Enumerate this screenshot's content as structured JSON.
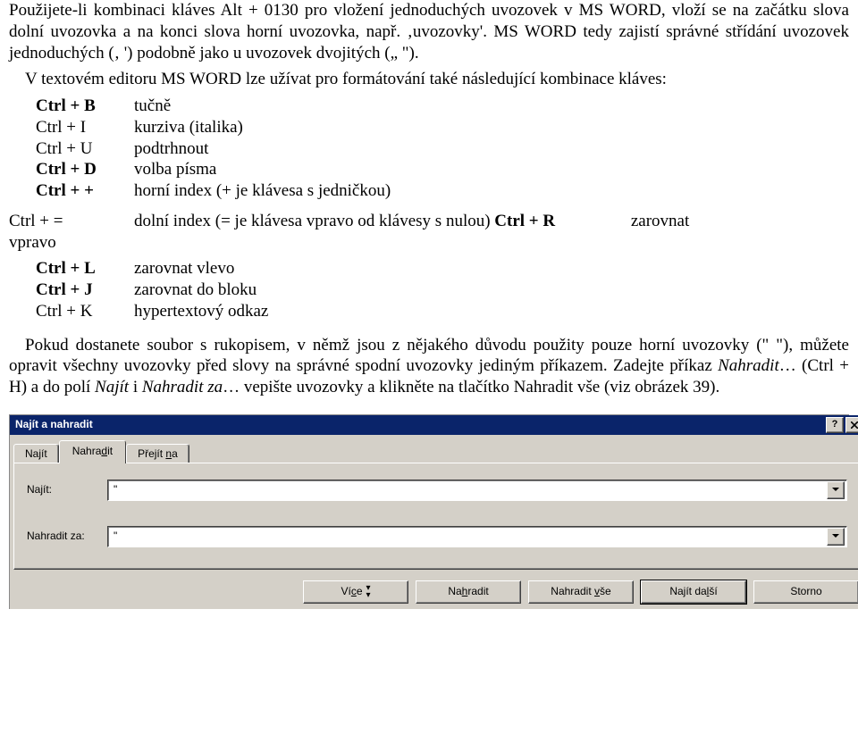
{
  "doc": {
    "p1": "Použijete-li kombinaci kláves Alt + 0130 pro vložení jednoduchých uvozovek v MS WORD, vloží se na začátku slova dolní uvozovka a na konci slova horní uvozovka, např. ‚uvozovky'. MS WORD tedy zajistí správné střídání uvozovek jednoduchých (‚ ') podobně jako u uvozovek dvojitých („ \").",
    "p2": "V textovém editoru MS WORD lze užívat pro formátování také následující kombinace kláves:",
    "shortcuts": [
      {
        "key": "Ctrl + B",
        "bold": true,
        "desc": "tučně"
      },
      {
        "key": "Ctrl + I",
        "bold": false,
        "desc": "kurziva (italika)"
      },
      {
        "key": "Ctrl + U",
        "bold": false,
        "desc": "podtrhnout"
      },
      {
        "key": "Ctrl + D",
        "bold": true,
        "desc": "volba písma"
      },
      {
        "key": "Ctrl + +",
        "bold": true,
        "desc": "horní index (+ je klávesa s jedničkou)"
      }
    ],
    "eq_row": {
      "key": "Ctrl + =",
      "mid": "dolní index (= je klávesa vpravo od klávesy s nulou) ",
      "ctrlR": "Ctrl + R",
      "tail": "zarovnat"
    },
    "vpravo": "vpravo",
    "shortcuts2": [
      {
        "key": "Ctrl + L",
        "bold": true,
        "desc": "zarovnat vlevo"
      },
      {
        "key": "Ctrl + J",
        "bold": true,
        "desc": "zarovnat do bloku"
      },
      {
        "key": "Ctrl + K",
        "bold": false,
        "desc": "hypertextový odkaz"
      }
    ],
    "p3a": "Pokud dostanete soubor s rukopisem, v němž jsou z nějakého důvodu použity pouze horní uvozovky (\" \"), můžete opravit všechny uvozovky před slovy na správné spodní uvozovky jediným příkazem. Zadejte příkaz ",
    "p3b": "Nahradit",
    "p3c": "… (Ctrl + H) a do polí ",
    "p3d": "Najít",
    "p3e": " i ",
    "p3f": "Nahradit za",
    "p3g": "… vepište uvozovky a klikněte na tlačítko Nahradit vše (viz obrázek 39)."
  },
  "dialog": {
    "title": "Najít a nahradit",
    "help_icon": "help-icon",
    "close_icon": "close-icon",
    "tabs": {
      "find": "Najít",
      "replace": "Nahradit",
      "goto": "Přejít na",
      "find_u": "j",
      "replace_u": "d",
      "goto_u": "n"
    },
    "fields": {
      "find_label": "Najít:",
      "replace_label": "Nahradit za:",
      "find_value": "\"",
      "replace_value": "\""
    },
    "buttons": {
      "more": "Více",
      "more_u": "c",
      "replace_one_pre": "Na",
      "replace_one_u": "h",
      "replace_one_post": "radit",
      "replace_all_pre": "Nahradit ",
      "replace_all_u": "v",
      "replace_all_post": "še",
      "find_next_pre": "Najít da",
      "find_next_u": "l",
      "find_next_post": "ší",
      "cancel": "Storno"
    }
  }
}
